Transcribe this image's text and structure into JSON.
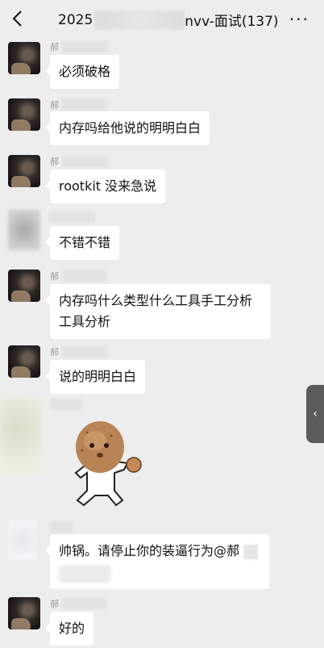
{
  "header": {
    "title_prefix": "2025",
    "title_suffix": "nvv-面试(137)",
    "more_icon": "more-icon",
    "back_icon": "back-arrow-icon"
  },
  "messages": [
    {
      "sender": "郝",
      "text": "必须破格"
    },
    {
      "sender": "郝",
      "text": "内存吗给他说的明明白白"
    },
    {
      "sender": "郝",
      "text": "rootkit 没来急说"
    },
    {
      "sender": "",
      "text": "不错不错"
    },
    {
      "sender": "郝",
      "text": "内存吗什么类型什么工具手工分析工具分析"
    },
    {
      "sender": "郝",
      "text": "说的明明白白"
    },
    {
      "sender": "",
      "sticker": "potato-character-sticker"
    },
    {
      "sender": "",
      "text": "帅锅。请停止你的装逼行为@郝"
    },
    {
      "sender": "郝",
      "text": "好的"
    }
  ],
  "side_tab": {
    "icon": "chevron-left-icon"
  },
  "colors": {
    "background": "#ededed",
    "bubble": "#ffffff",
    "text": "#111111"
  }
}
